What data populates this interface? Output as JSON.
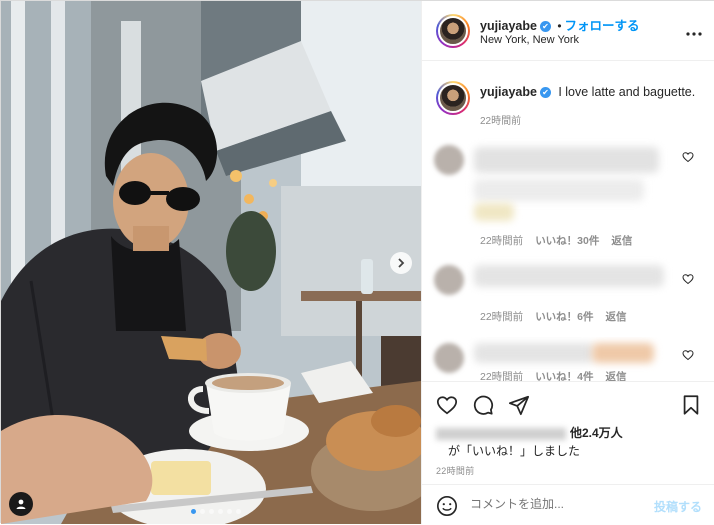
{
  "post": {
    "username": "yujiayabe",
    "verified_glyph": "✔",
    "follow_separator": "•",
    "follow_label": "フォローする",
    "location": "New York, New York",
    "more_icon": "more-horizontal-icon"
  },
  "caption": {
    "username": "yujiayabe",
    "text": "I love latte and baguette.",
    "timestamp": "22時間前"
  },
  "comments": [
    {
      "timestamp": "22時間前",
      "likes": "いいね！30件",
      "reply": "返信"
    },
    {
      "timestamp": "22時間前",
      "likes": "いいね！6件",
      "reply": "返信"
    },
    {
      "timestamp": "22時間前",
      "likes": "いいね！4件",
      "reply": "返信"
    }
  ],
  "actions": {
    "icons": [
      "heart-icon",
      "comment-icon",
      "share-icon",
      "bookmark-icon"
    ],
    "likes_others": "他2.4万人",
    "likes_suffix": "が「いいね！」しました",
    "timestamp": "22時間前"
  },
  "add_comment": {
    "placeholder": "コメントを追加...",
    "post_label": "投稿する"
  },
  "carousel": {
    "dot_count": 6,
    "active_index": 0
  },
  "colors": {
    "accent": "#0095f6",
    "verified": "#3897f0",
    "muted": "#8e8e8e",
    "post_disabled": "#b2dffc"
  }
}
